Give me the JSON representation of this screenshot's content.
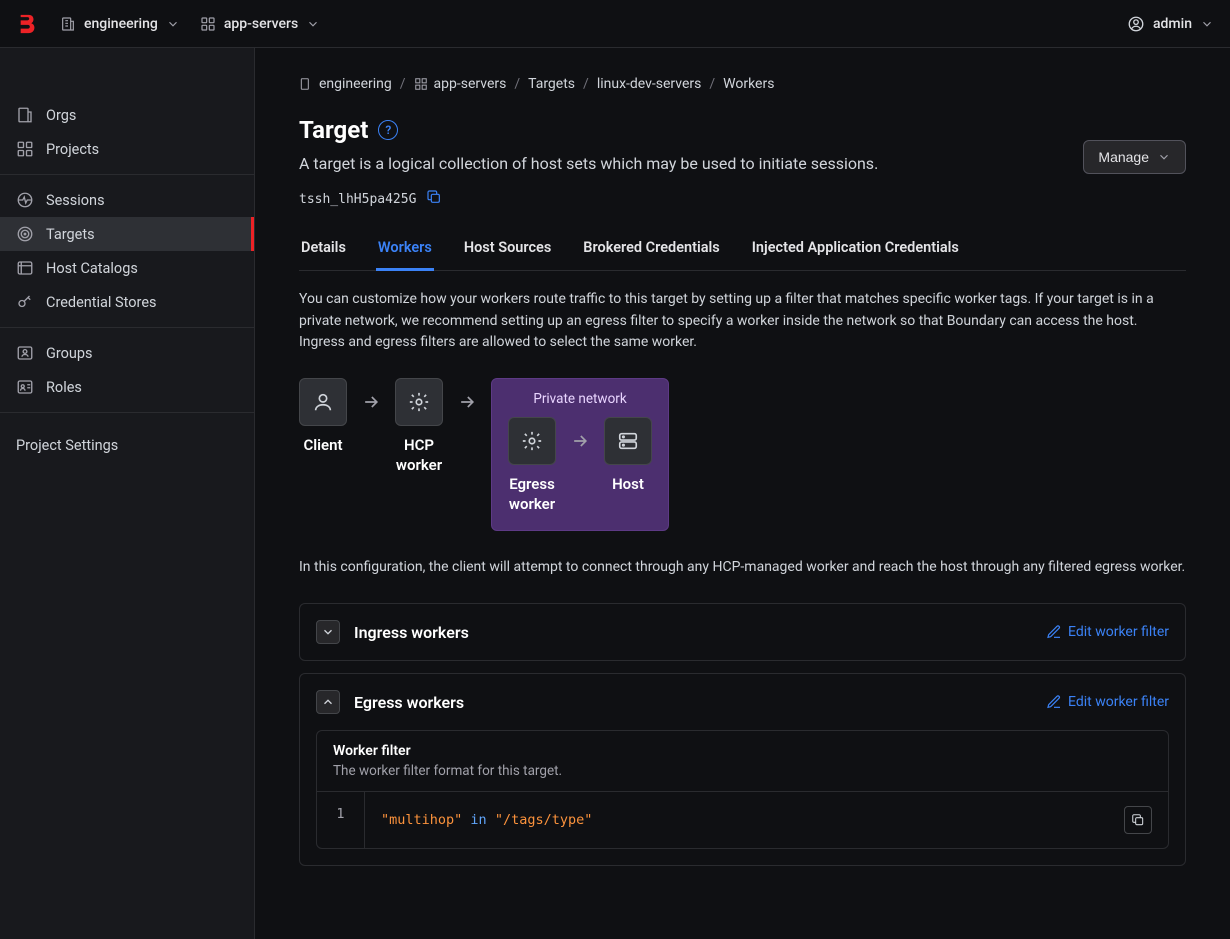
{
  "topbar": {
    "org": "engineering",
    "project": "app-servers",
    "user": "admin"
  },
  "sidebar": {
    "items": [
      {
        "label": "Orgs"
      },
      {
        "label": "Projects"
      },
      {
        "label": "Sessions"
      },
      {
        "label": "Targets"
      },
      {
        "label": "Host Catalogs"
      },
      {
        "label": "Credential Stores"
      },
      {
        "label": "Groups"
      },
      {
        "label": "Roles"
      }
    ],
    "settings": "Project Settings"
  },
  "breadcrumb": {
    "items": [
      "engineering",
      "app-servers",
      "Targets",
      "linux-dev-servers",
      "Workers"
    ]
  },
  "page": {
    "title": "Target",
    "subtitle": "A target is a logical collection of host sets which may be used to initiate sessions.",
    "manage": "Manage",
    "target_id": "tssh_lhH5pa425G"
  },
  "tabs": {
    "items": [
      "Details",
      "Workers",
      "Host Sources",
      "Brokered Credentials",
      "Injected Application Credentials"
    ],
    "active": "Workers"
  },
  "workers": {
    "desc": "You can customize how your workers route traffic to this target by setting up a filter that matches specific worker tags. If your target is in a private network, we recommend setting up an egress filter to specify a worker inside the network so that Boundary can access the host. Ingress and egress filters are allowed to select the same worker.",
    "diagram": {
      "client": "Client",
      "hcp_worker": "HCP worker",
      "private_network": "Private network",
      "egress_worker": "Egress worker",
      "host": "Host"
    },
    "desc2": "In this configuration, the client will attempt to connect through any HCP-managed worker and reach the host through any filtered egress worker.",
    "ingress": {
      "title": "Ingress workers",
      "edit": "Edit worker filter"
    },
    "egress": {
      "title": "Egress workers",
      "edit": "Edit worker filter",
      "filter_title": "Worker filter",
      "filter_sub": "The worker filter format for this target.",
      "line_no": "1",
      "code_str1": "\"multihop\"",
      "code_kw": "in",
      "code_str2": "\"/tags/type\""
    }
  }
}
